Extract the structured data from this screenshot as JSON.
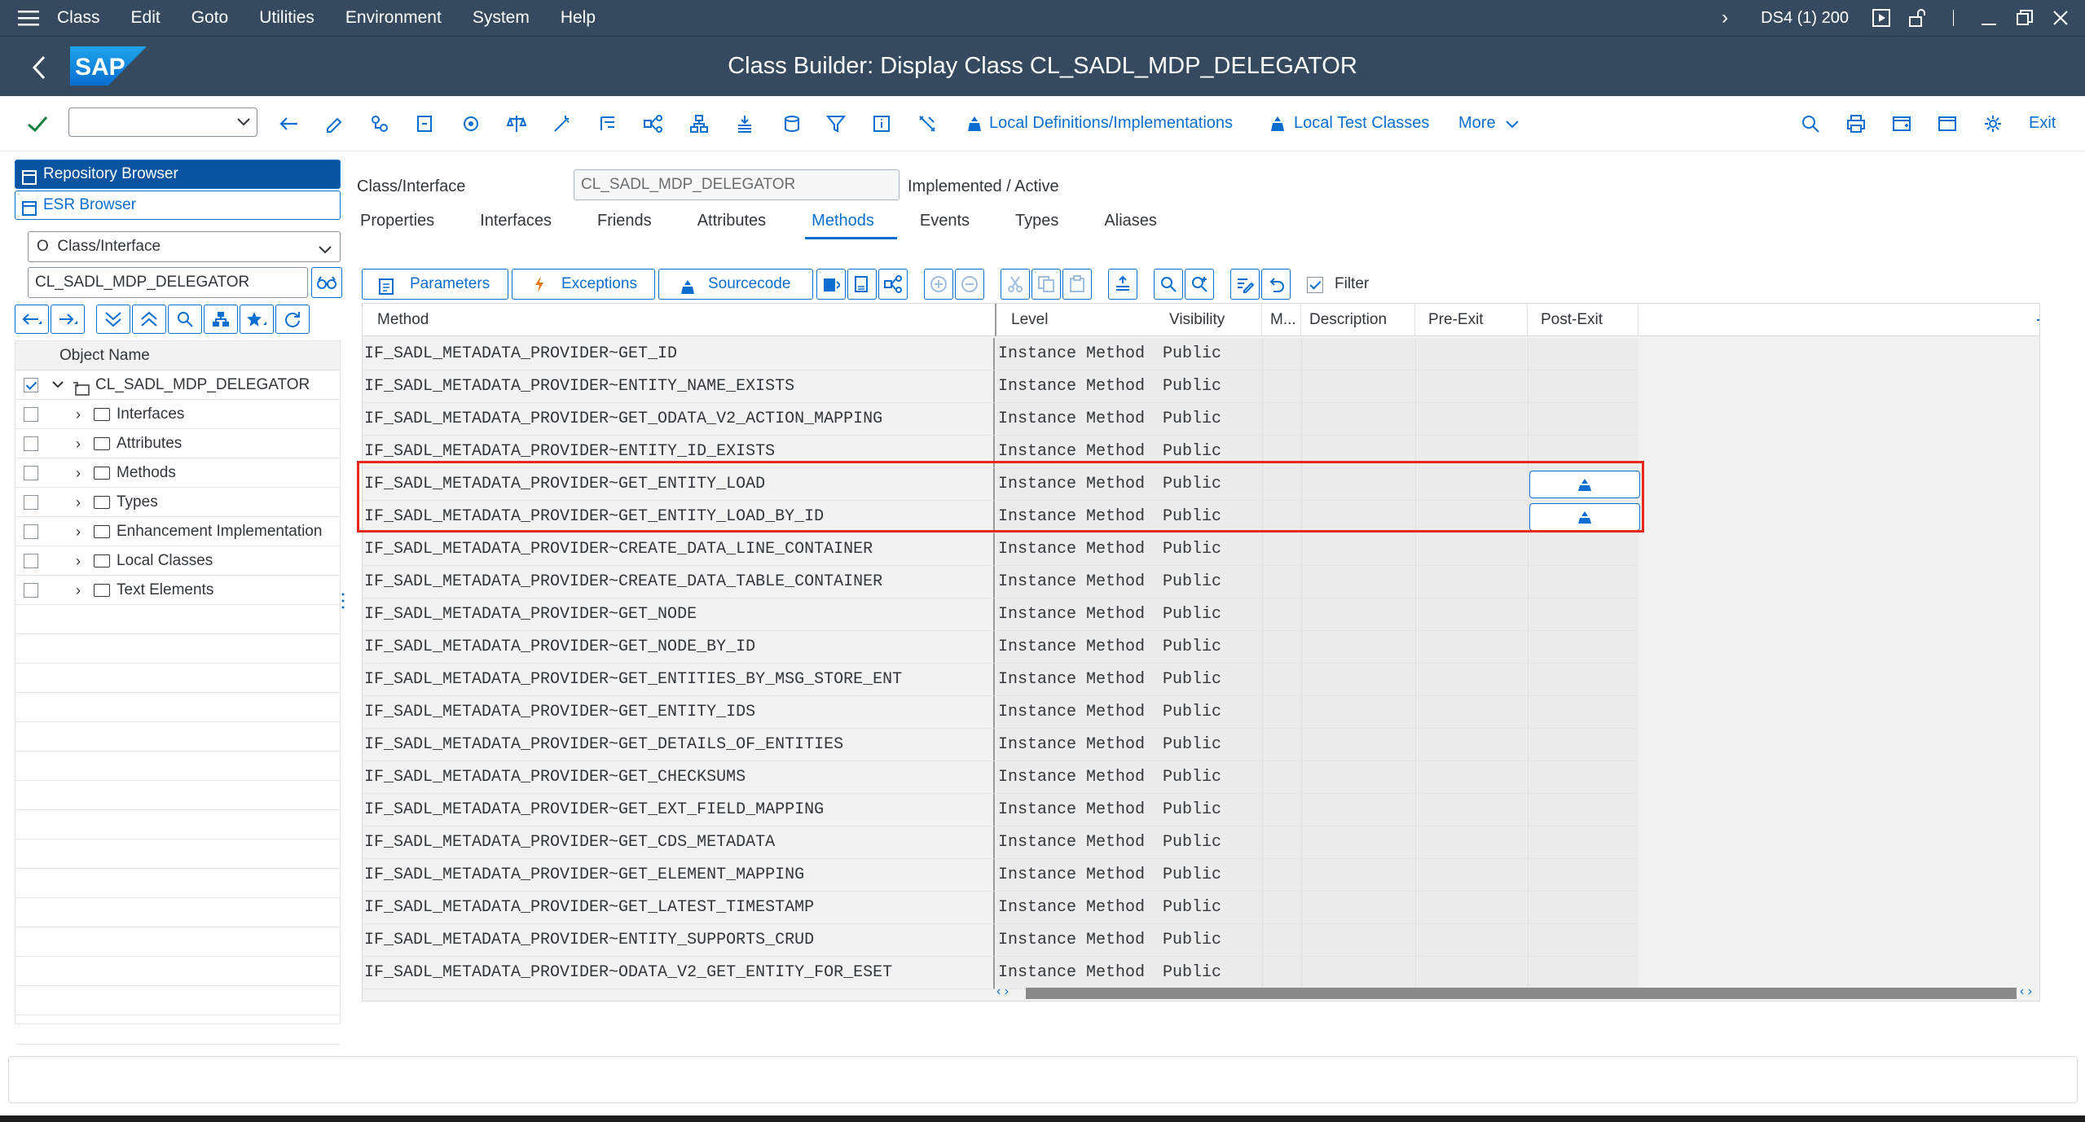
{
  "menubar": {
    "items": [
      "Class",
      "Edit",
      "Goto",
      "Utilities",
      "Environment",
      "System",
      "Help"
    ],
    "system": "DS4 (1) 200"
  },
  "titlebar": {
    "title": "Class Builder: Display Class CL_SADL_MDP_DELEGATOR",
    "logo_text": "SAP"
  },
  "toolbar": {
    "local_defs": "Local Definitions/Implementations",
    "local_tests": "Local Test Classes",
    "more": "More",
    "exit": "Exit"
  },
  "left": {
    "repo_browser": "Repository Browser",
    "esr_browser": "ESR Browser",
    "object_type": "Class/Interface",
    "object_type_marker": "O",
    "object_name": "CL_SADL_MDP_DELEGATOR",
    "tree_header": "Object Name",
    "root": "CL_SADL_MDP_DELEGATOR",
    "nodes": [
      "Interfaces",
      "Attributes",
      "Methods",
      "Types",
      "Enhancement Implementation",
      "Local Classes",
      "Text Elements"
    ]
  },
  "main": {
    "class_label": "Class/Interface",
    "class_value": "CL_SADL_MDP_DELEGATOR",
    "status": "Implemented / Active",
    "tabs": [
      "Properties",
      "Interfaces",
      "Friends",
      "Attributes",
      "Methods",
      "Events",
      "Types",
      "Aliases"
    ],
    "active_tab": "Methods",
    "buttons": {
      "parameters": "Parameters",
      "exceptions": "Exceptions",
      "sourcecode": "Sourcecode",
      "filter": "Filter"
    },
    "columns": [
      "Method",
      "Level",
      "Visibility",
      "M...",
      "Description",
      "Pre-Exit",
      "Post-Exit"
    ],
    "rows": [
      {
        "method": "IF_SADL_METADATA_PROVIDER~GET_ID",
        "level": "Instance Method",
        "vis": "Public",
        "post": false
      },
      {
        "method": "IF_SADL_METADATA_PROVIDER~ENTITY_NAME_EXISTS",
        "level": "Instance Method",
        "vis": "Public",
        "post": false
      },
      {
        "method": "IF_SADL_METADATA_PROVIDER~GET_ODATA_V2_ACTION_MAPPING",
        "level": "Instance Method",
        "vis": "Public",
        "post": false
      },
      {
        "method": "IF_SADL_METADATA_PROVIDER~ENTITY_ID_EXISTS",
        "level": "Instance Method",
        "vis": "Public",
        "post": false
      },
      {
        "method": "IF_SADL_METADATA_PROVIDER~GET_ENTITY_LOAD",
        "level": "Instance Method",
        "vis": "Public",
        "post": true
      },
      {
        "method": "IF_SADL_METADATA_PROVIDER~GET_ENTITY_LOAD_BY_ID",
        "level": "Instance Method",
        "vis": "Public",
        "post": true
      },
      {
        "method": "IF_SADL_METADATA_PROVIDER~CREATE_DATA_LINE_CONTAINER",
        "level": "Instance Method",
        "vis": "Public",
        "post": false
      },
      {
        "method": "IF_SADL_METADATA_PROVIDER~CREATE_DATA_TABLE_CONTAINER",
        "level": "Instance Method",
        "vis": "Public",
        "post": false
      },
      {
        "method": "IF_SADL_METADATA_PROVIDER~GET_NODE",
        "level": "Instance Method",
        "vis": "Public",
        "post": false
      },
      {
        "method": "IF_SADL_METADATA_PROVIDER~GET_NODE_BY_ID",
        "level": "Instance Method",
        "vis": "Public",
        "post": false
      },
      {
        "method": "IF_SADL_METADATA_PROVIDER~GET_ENTITIES_BY_MSG_STORE_ENT",
        "level": "Instance Method",
        "vis": "Public",
        "post": false
      },
      {
        "method": "IF_SADL_METADATA_PROVIDER~GET_ENTITY_IDS",
        "level": "Instance Method",
        "vis": "Public",
        "post": false
      },
      {
        "method": "IF_SADL_METADATA_PROVIDER~GET_DETAILS_OF_ENTITIES",
        "level": "Instance Method",
        "vis": "Public",
        "post": false
      },
      {
        "method": "IF_SADL_METADATA_PROVIDER~GET_CHECKSUMS",
        "level": "Instance Method",
        "vis": "Public",
        "post": false
      },
      {
        "method": "IF_SADL_METADATA_PROVIDER~GET_EXT_FIELD_MAPPING",
        "level": "Instance Method",
        "vis": "Public",
        "post": false
      },
      {
        "method": "IF_SADL_METADATA_PROVIDER~GET_CDS_METADATA",
        "level": "Instance Method",
        "vis": "Public",
        "post": false
      },
      {
        "method": "IF_SADL_METADATA_PROVIDER~GET_ELEMENT_MAPPING",
        "level": "Instance Method",
        "vis": "Public",
        "post": false
      },
      {
        "method": "IF_SADL_METADATA_PROVIDER~GET_LATEST_TIMESTAMP",
        "level": "Instance Method",
        "vis": "Public",
        "post": false
      },
      {
        "method": "IF_SADL_METADATA_PROVIDER~ENTITY_SUPPORTS_CRUD",
        "level": "Instance Method",
        "vis": "Public",
        "post": false
      },
      {
        "method": "IF_SADL_METADATA_PROVIDER~ODATA_V2_GET_ENTITY_FOR_ESET",
        "level": "Instance Method",
        "vis": "Public",
        "post": false
      }
    ]
  },
  "colors": {
    "shell": "#354a5f",
    "accent": "#0a6ed1",
    "highlight": "#e8281d"
  }
}
